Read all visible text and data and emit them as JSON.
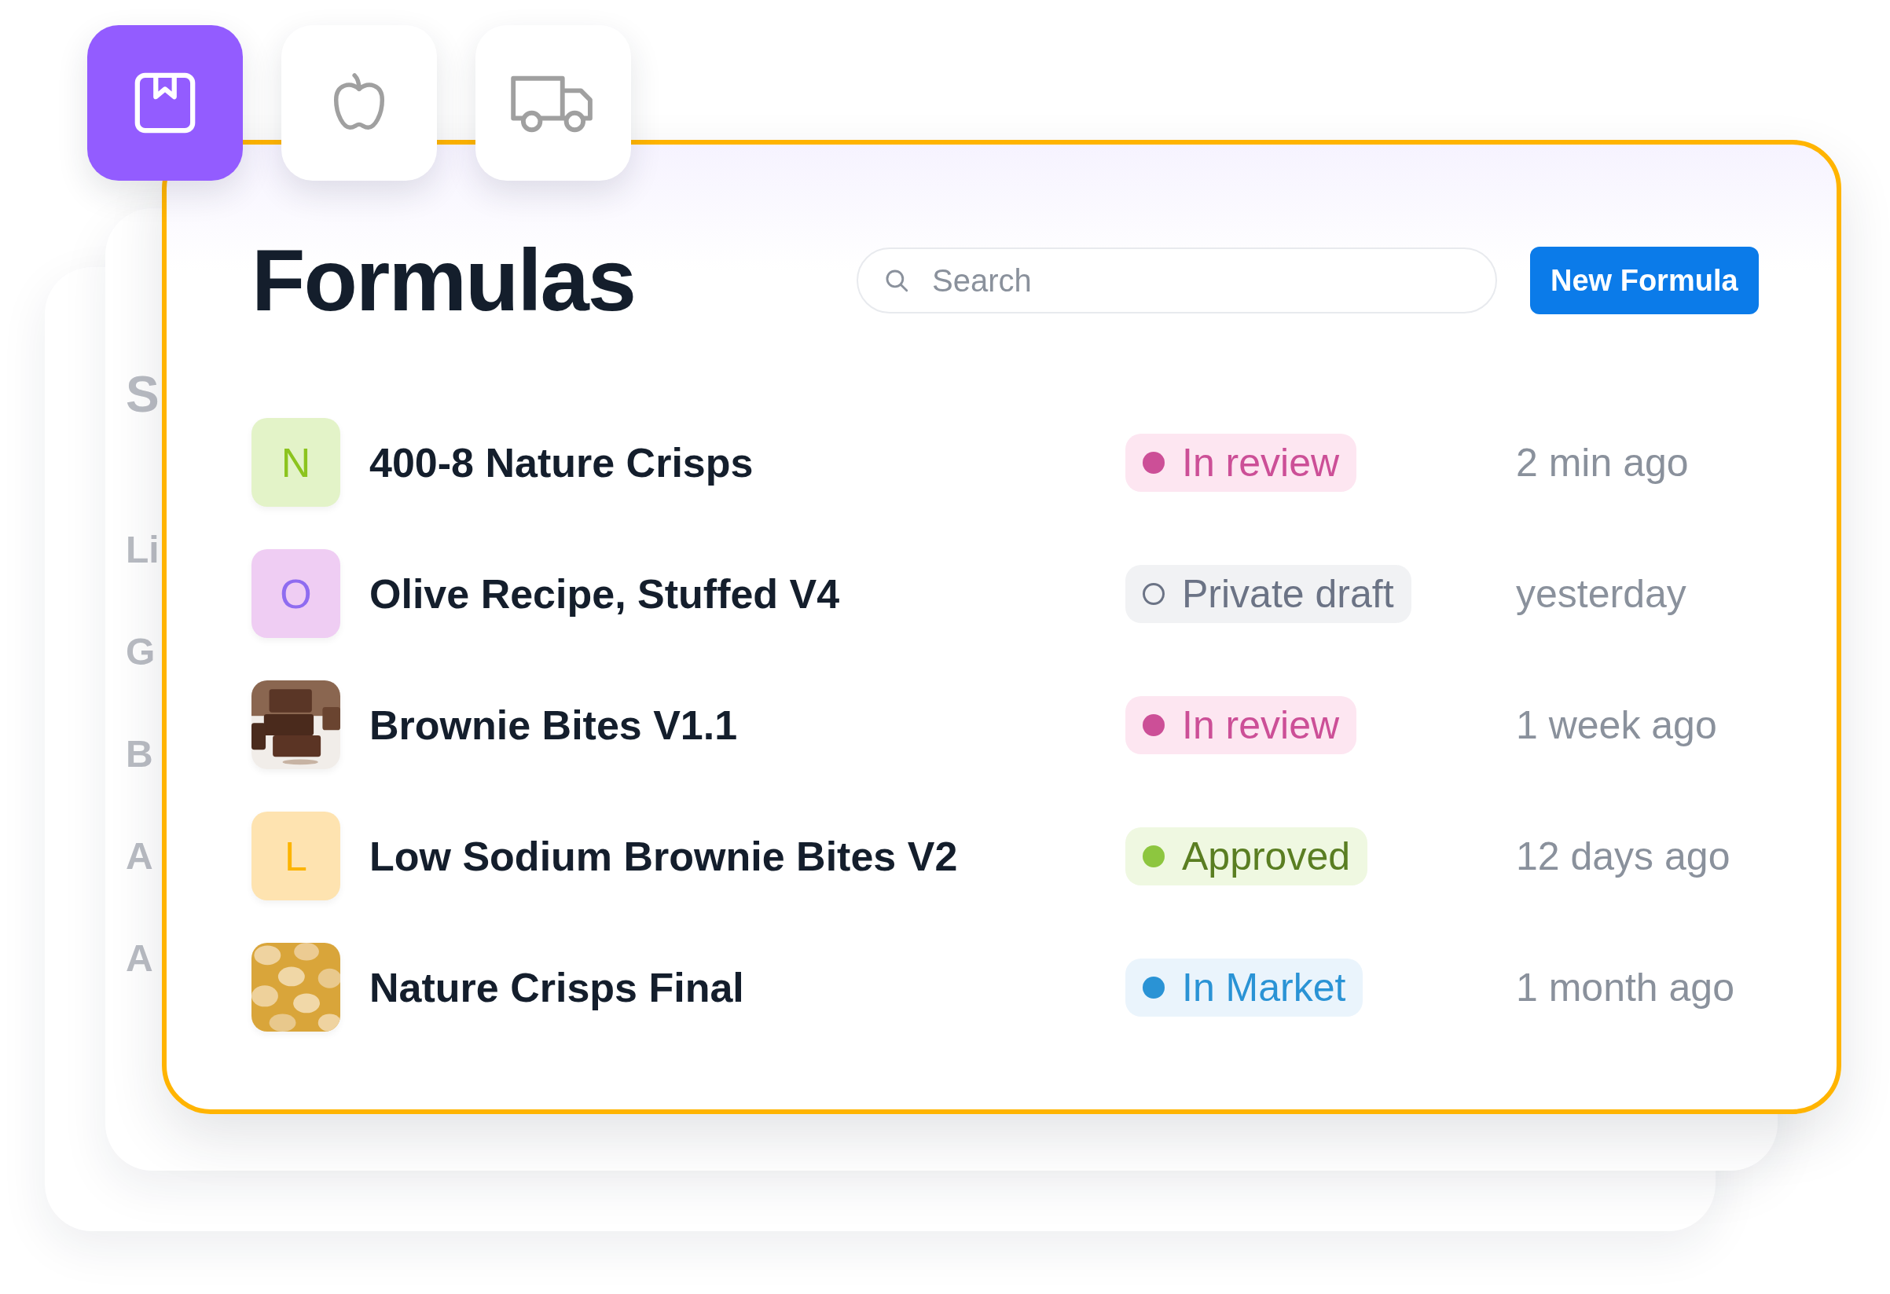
{
  "tabs": [
    {
      "kind": "bookmark",
      "selected": true
    },
    {
      "kind": "apple",
      "selected": false
    },
    {
      "kind": "truck",
      "selected": false
    }
  ],
  "background_card": {
    "labels": [
      "S",
      "Li",
      "G",
      "B",
      "A",
      "A"
    ]
  },
  "title": "Formulas",
  "search": {
    "placeholder": "Search"
  },
  "new_button": "New Formula",
  "rows": [
    {
      "avatar": {
        "kind": "letter",
        "letter": "N",
        "color": "#e3f3c8"
      },
      "name": "400-8 Nature Crisps",
      "status": {
        "kind": "review",
        "label": "In review"
      },
      "time": "2 min ago"
    },
    {
      "avatar": {
        "kind": "letter",
        "letter": "O",
        "color": "#efcdf3"
      },
      "name": "Olive Recipe, Stuffed V4",
      "status": {
        "kind": "draft",
        "label": "Private draft"
      },
      "time": "yesterday"
    },
    {
      "name": "Brownie Bites V1.1",
      "status": {
        "kind": "review",
        "label": "In review"
      },
      "time": "1 week ago"
    },
    {
      "avatar": {
        "kind": "letter",
        "letter": "L",
        "color": "#fee3b0"
      },
      "name": "Low Sodium Brownie Bites V2",
      "status": {
        "kind": "approved",
        "label": "Approved"
      },
      "time": "12 days ago"
    },
    {
      "name": "Nature Crisps Final",
      "status": {
        "kind": "market",
        "label": "In Market"
      },
      "time": "1 month ago"
    }
  ]
}
